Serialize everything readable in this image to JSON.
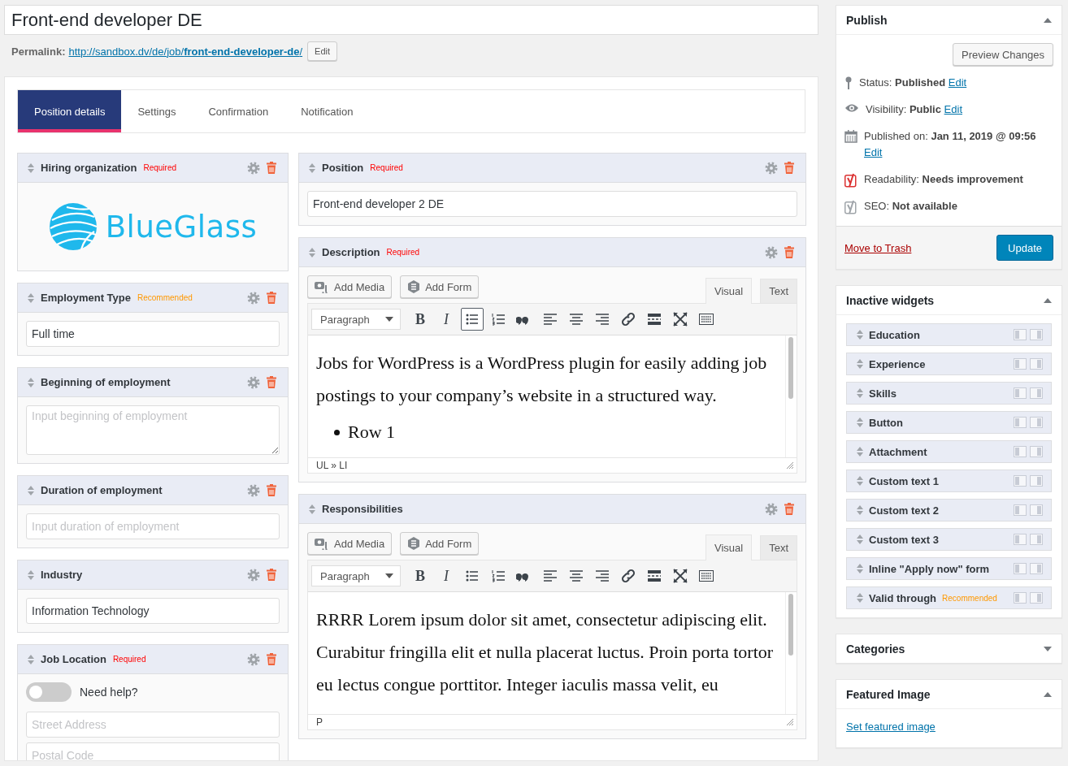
{
  "title_field": {
    "value": "Front-end developer DE"
  },
  "permalink": {
    "label": "Permalink:",
    "url": "http://sandbox.dv/de/job/**front-end-developer-de**/",
    "edit_button": "Edit"
  },
  "tabs": [
    {
      "label": "Position details",
      "selected": true
    },
    {
      "label": "Settings",
      "selected": false
    },
    {
      "label": "Confirmation",
      "selected": false
    },
    {
      "label": "Notification",
      "selected": false
    }
  ],
  "left_widgets": [
    {
      "title": "Hiring organization",
      "badge": {
        "text": "Required",
        "kind": "required"
      },
      "kind": "logo",
      "logo_text": "BlueGlass"
    },
    {
      "title": "Employment Type",
      "badge": {
        "text": "Recommended",
        "kind": "recommended"
      },
      "kind": "input",
      "value": "Full time"
    },
    {
      "title": "Beginning of employment",
      "kind": "textarea",
      "placeholder": "Input beginning of employment"
    },
    {
      "title": "Duration of employment",
      "kind": "input",
      "placeholder": "Input duration of employment"
    },
    {
      "title": "Industry",
      "kind": "input",
      "value": "Information Technology"
    },
    {
      "title": "Job Location",
      "badge": {
        "text": "Required",
        "kind": "required"
      },
      "kind": "location",
      "toggle": {
        "label": "Need help?",
        "on": false
      },
      "fields": [
        {
          "placeholder": "Street Address"
        },
        {
          "placeholder": "Postal Code"
        }
      ]
    }
  ],
  "right_widgets": [
    {
      "title": "Position",
      "badge": {
        "text": "Required",
        "kind": "required"
      },
      "kind": "input",
      "value": "Front-end developer 2 DE"
    },
    {
      "title": "Description",
      "badge": {
        "text": "Required",
        "kind": "required"
      },
      "kind": "editor",
      "editor": {
        "media_button": "Add Media",
        "form_button": "Add Form",
        "modes": [
          {
            "label": "Visual",
            "selected": true
          },
          {
            "label": "Text",
            "selected": false
          }
        ],
        "format": "Paragraph",
        "toolbar": [
          {
            "kind": "bold",
            "glyph": "B",
            "active": false
          },
          {
            "kind": "italic",
            "glyph": "I",
            "active": false
          },
          {
            "kind": "bullet-list",
            "active": true
          },
          {
            "kind": "numbered-list",
            "active": false
          },
          {
            "kind": "quote",
            "active": false
          },
          {
            "kind": "align-left",
            "active": false
          },
          {
            "kind": "align-center",
            "active": false
          },
          {
            "kind": "align-right",
            "active": false
          },
          {
            "kind": "link",
            "active": false
          },
          {
            "kind": "more",
            "active": false
          },
          {
            "kind": "fullscreen",
            "active": false
          },
          {
            "kind": "toolbar-toggle",
            "active": false
          }
        ],
        "content": [
          {
            "kind": "paragraph",
            "text": "Jobs for WordPress is a WordPress plugin for easily adding job postings to your company’s website in a structured way."
          },
          {
            "kind": "bullet",
            "text": "Row 1"
          }
        ],
        "path": "UL » LI"
      }
    },
    {
      "title": "Responsibilities",
      "kind": "editor",
      "editor": {
        "media_button": "Add Media",
        "form_button": "Add Form",
        "modes": [
          {
            "label": "Visual",
            "selected": true
          },
          {
            "label": "Text",
            "selected": false
          }
        ],
        "format": "Paragraph",
        "toolbar": [
          {
            "kind": "bold",
            "glyph": "B",
            "active": false
          },
          {
            "kind": "italic",
            "glyph": "I",
            "active": false
          },
          {
            "kind": "bullet-list",
            "active": false
          },
          {
            "kind": "numbered-list",
            "active": false
          },
          {
            "kind": "quote",
            "active": false
          },
          {
            "kind": "align-left",
            "active": false
          },
          {
            "kind": "align-center",
            "active": false
          },
          {
            "kind": "align-right",
            "active": false
          },
          {
            "kind": "link",
            "active": false
          },
          {
            "kind": "more",
            "active": false
          },
          {
            "kind": "fullscreen",
            "active": false
          },
          {
            "kind": "toolbar-toggle",
            "active": false
          }
        ],
        "content": [
          {
            "kind": "paragraph",
            "text": "RRRR Lorem ipsum dolor sit amet, consectetur adipiscing elit. Curabitur fringilla elit et nulla placerat luctus. Proin porta tortor eu lectus congue porttitor. Integer iaculis massa velit, eu"
          }
        ],
        "path": "P"
      }
    }
  ],
  "sidebar": [
    {
      "kind": "publish",
      "title": "Publish",
      "expanded": true,
      "preview_button": "Preview Changes",
      "rows": [
        {
          "kind": "status",
          "label": "Status:",
          "value": "Published",
          "link": "Edit"
        },
        {
          "kind": "visibility",
          "label": "Visibility:",
          "value": "Public",
          "link": "Edit"
        },
        {
          "kind": "date",
          "label": "Published on:",
          "value": "Jan 11, 2019 @ 09:56",
          "link": "Edit"
        },
        {
          "kind": "readability",
          "label": "Readability:",
          "value": "Needs improvement"
        },
        {
          "kind": "seo",
          "label": "SEO:",
          "value": "Not available"
        }
      ],
      "trash_link": "Move to Trash",
      "update_button": "Update"
    },
    {
      "kind": "widgets",
      "title": "Inactive widgets",
      "expanded": true,
      "items": [
        {
          "title": "Education"
        },
        {
          "title": "Experience"
        },
        {
          "title": "Skills"
        },
        {
          "title": "Button"
        },
        {
          "title": "Attachment"
        },
        {
          "title": "Custom text 1"
        },
        {
          "title": "Custom text 2"
        },
        {
          "title": "Custom text 3"
        },
        {
          "title": "Inline \"Apply now\" form"
        },
        {
          "title": "Valid through",
          "badge": {
            "text": "Recommended",
            "kind": "recommended"
          }
        }
      ]
    },
    {
      "kind": "categories",
      "title": "Categories",
      "expanded": false
    },
    {
      "kind": "featured",
      "title": "Featured Image",
      "expanded": true,
      "link": "Set featured image"
    }
  ]
}
